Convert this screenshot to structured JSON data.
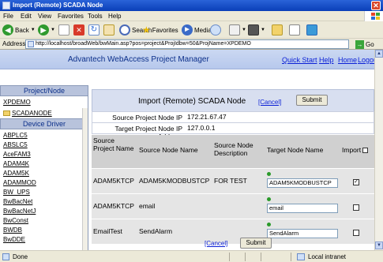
{
  "window": {
    "title": "Import (Remote) SCADA Node"
  },
  "menu": [
    "File",
    "Edit",
    "View",
    "Favorites",
    "Tools",
    "Help"
  ],
  "toolbar": {
    "back": "Back",
    "search": "Search",
    "favorites": "Favorites",
    "media": "Media"
  },
  "address": {
    "label": "Address",
    "url": "http://localhost/broadWeb/bwMain.asp?pos=project&ProjIdbw=50&ProjName=XPDEMO",
    "go": "Go"
  },
  "banner": {
    "title": "Advantech WebAccess Project Manager",
    "links": [
      "Quick Start",
      "Help",
      "Home",
      "Logout"
    ]
  },
  "sidebar": {
    "project_header": "Project/Node",
    "project": "XPDEMO",
    "node": "SCADANODE",
    "driver_header": "Device Driver",
    "drivers": [
      "ABPLC5",
      "ABSLC5",
      "AceFAM3",
      "ADAM4K",
      "ADAM5K",
      "ADAMMOD",
      "BW_UPS",
      "BwBacNet",
      "BwBacNetJ",
      "BwConst",
      "BWDB",
      "BwDDE"
    ]
  },
  "form": {
    "title": "Import (Remote) SCADA Node",
    "cancel": "[Cancel]",
    "submit": "Submit",
    "source_ip_label": "Source Project Node IP Address",
    "source_ip": "172.21.67.47",
    "target_ip_label": "Target Project Node IP Address",
    "target_ip": "127.0.0.1",
    "columns": {
      "source_project": "Source Project Name",
      "source_node": "Source Node Name",
      "source_desc": "Source Node Description",
      "target_node": "Target Node Name",
      "import": "Import"
    },
    "rows": [
      {
        "project": "ADAM5KTCP",
        "node": "ADAM5KMODBUSTCP",
        "desc": "FOR TEST",
        "target": "ADAM5KMODBUSTCP",
        "checked": true
      },
      {
        "project": "ADAM5KTCP",
        "node": "email",
        "desc": "",
        "target": "email",
        "checked": false
      },
      {
        "project": "EmailTest",
        "node": "SendAlarm",
        "desc": "",
        "target": "SendAlarm",
        "checked": false
      }
    ]
  },
  "status": {
    "left": "Done",
    "zone": "Local intranet"
  }
}
